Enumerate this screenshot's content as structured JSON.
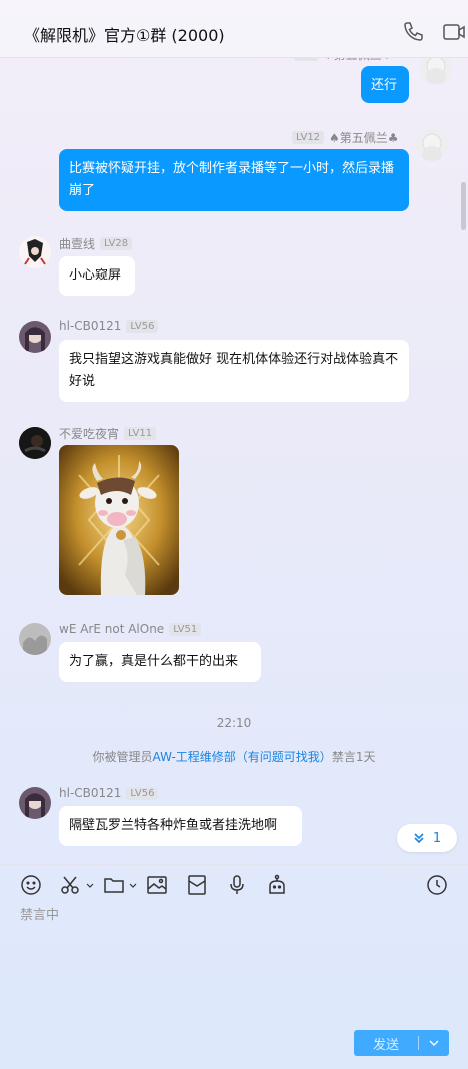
{
  "header": {
    "title": "《解限机》官方①群 (2000)",
    "icons": [
      "phone-icon",
      "video-call-icon"
    ]
  },
  "messages": {
    "m1": {
      "text": "还行"
    },
    "m2": {
      "name": "♠第五佩兰♣",
      "level": "LV12",
      "text": "比赛被怀疑开挂，放个制作者录播等了一小时，然后录播崩了"
    },
    "m3": {
      "name": "曲壹线",
      "level": "LV28",
      "text": "小心窥屏"
    },
    "m4": {
      "name": "hl-CB0121",
      "level": "LV56",
      "text": "我只指望这游戏真能做好 现在机体体验还行对战体验真不好说"
    },
    "m5": {
      "name": "不爱吃夜宵",
      "level": "LV11",
      "image": "cow-sticker-image"
    },
    "m6": {
      "name": "wE ArE not AlOne",
      "level": "LV51",
      "text": "为了赢，真是什么都干的出来"
    },
    "time": "22:10",
    "system": {
      "prefix": "你被管理员",
      "link": "AW-工程维修部（有问题可找我）",
      "suffix": "禁言1天"
    },
    "m7": {
      "name": "hl-CB0121",
      "level": "LV56",
      "text": "隔壁瓦罗兰特各种炸鱼或者挂洗地啊"
    }
  },
  "jump_button": {
    "count": "1"
  },
  "toolbar": {
    "icons": [
      "emoji-icon",
      "scissors-icon",
      "folder-icon",
      "image-icon",
      "red-packet-icon",
      "microphone-icon",
      "robot-icon",
      "history-icon"
    ]
  },
  "input": {
    "muted_text": "禁言中"
  },
  "send": {
    "label": "发送"
  },
  "colors": {
    "self_bubble": "#0a99ff",
    "accent": "#1a83e0",
    "send_button": "#40aaff"
  }
}
